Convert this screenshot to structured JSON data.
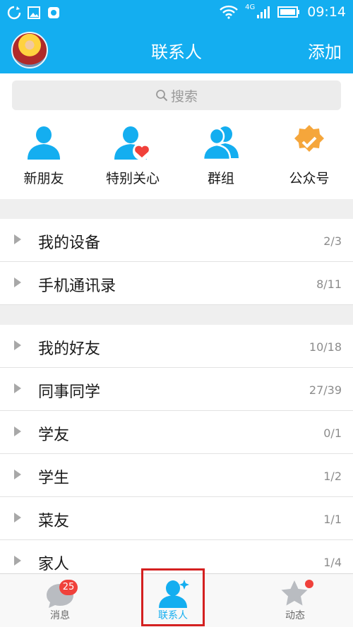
{
  "status_bar": {
    "network": "4G",
    "time": "09:14"
  },
  "header": {
    "title": "联系人",
    "add_label": "添加"
  },
  "search": {
    "placeholder": "搜索"
  },
  "quick_entries": [
    {
      "label": "新朋友",
      "icon": "person-icon"
    },
    {
      "label": "特别关心",
      "icon": "person-heart-icon"
    },
    {
      "label": "群组",
      "icon": "group-icon"
    },
    {
      "label": "公众号",
      "icon": "verified-badge-icon"
    }
  ],
  "system_groups": [
    {
      "name": "我的设备",
      "count": "2/3"
    },
    {
      "name": "手机通讯录",
      "count": "8/11"
    }
  ],
  "friend_groups": [
    {
      "name": "我的好友",
      "count": "10/18"
    },
    {
      "name": "同事同学",
      "count": "27/39"
    },
    {
      "name": "学友",
      "count": "0/1"
    },
    {
      "name": "学生",
      "count": "1/2"
    },
    {
      "name": "菜友",
      "count": "1/1"
    },
    {
      "name": "家人",
      "count": "1/4"
    }
  ],
  "tabs": [
    {
      "label": "消息",
      "badge": "25"
    },
    {
      "label": "联系人",
      "active": true
    },
    {
      "label": "动态",
      "dot": true
    }
  ],
  "colors": {
    "accent": "#14aef0",
    "badge": "#f0413b",
    "highlight_box": "#d42020",
    "verified": "#f5a63b",
    "heart": "#f0413b"
  }
}
